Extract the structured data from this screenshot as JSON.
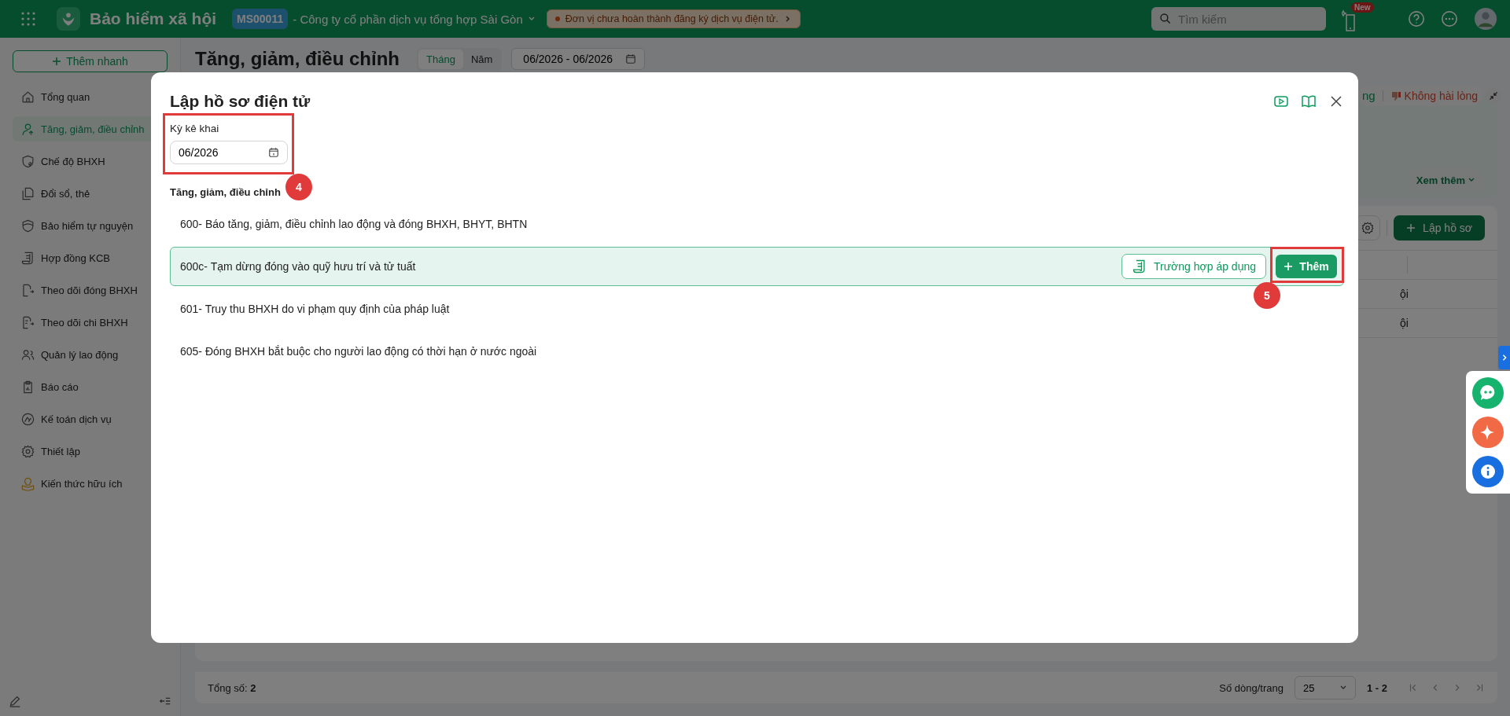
{
  "app": {
    "title": "Bảo hiểm xã hội",
    "org_code": "MS00011",
    "org_name": "- Công ty cổ phần dịch vụ tổng hợp Sài Gòn",
    "notice": "Đơn vị chưa hoàn thành đăng ký dịch vụ điện tử.",
    "search": {
      "placeholder": "Tìm kiếm"
    },
    "new_badge": "New"
  },
  "sidebar": {
    "quick_add": "Thêm nhanh",
    "items": [
      {
        "label": "Tổng quan",
        "selected": false
      },
      {
        "label": "Tăng, giảm, điều chỉnh",
        "selected": true
      },
      {
        "label": "Chế độ BHXH",
        "selected": false
      },
      {
        "label": "Đổi sổ, thẻ",
        "selected": false
      },
      {
        "label": "Bảo hiểm tự nguyện",
        "selected": false
      },
      {
        "label": "Hợp đồng KCB",
        "selected": false
      },
      {
        "label": "Theo dõi đóng BHXH",
        "selected": false
      },
      {
        "label": "Theo dõi chi BHXH",
        "selected": false
      },
      {
        "label": "Quản lý lao động",
        "selected": false
      },
      {
        "label": "Báo cáo",
        "selected": false
      },
      {
        "label": "Kế toán dịch vụ",
        "selected": false
      },
      {
        "label": "Thiết lập",
        "selected": false
      },
      {
        "label": "Kiến thức hữu ích",
        "selected": false
      }
    ]
  },
  "page": {
    "title": "Tăng, giảm, điều chỉnh",
    "period_tabs": [
      {
        "label": "Tháng",
        "selected": true
      },
      {
        "label": "Năm",
        "selected": false
      }
    ],
    "date_range": "06/2026 - 06/2026",
    "feedback_partial": "ng",
    "feedback_negative": "Không hài lòng",
    "see_more": "Xem thêm",
    "create_button": "Lập hồ sơ",
    "table_cells": [
      "ội",
      "ội"
    ],
    "total_label": "Tổng số:",
    "total": "2",
    "rows_per_page_label": "Số dòng/trang",
    "rows_per_page": "25",
    "range": "1 - 2"
  },
  "modal": {
    "title": "Lập hồ sơ điện tử",
    "period_label": "Kỳ kê khai",
    "period_value": "06/2026",
    "period_marker": "4",
    "section": "Tăng, giảm, điều chỉnh",
    "forms": [
      {
        "code": "600-",
        "name": "Báo tăng, giảm, điều chỉnh lao động và đóng BHXH, BHYT, BHTN",
        "selected": false
      },
      {
        "code": "600c-",
        "name": "Tạm dừng đóng vào quỹ hưu trí và tử tuất",
        "selected": true
      },
      {
        "code": "601-",
        "name": "Truy thu BHXH do vi phạm quy định của pháp luật",
        "selected": false
      },
      {
        "code": "605-",
        "name": "Đóng BHXH bắt buộc cho người lao động có thời hạn ở nước ngoài",
        "selected": false
      }
    ],
    "cases_button": "Trường hợp áp dụng",
    "add_button": "Thêm",
    "add_marker": "5"
  }
}
